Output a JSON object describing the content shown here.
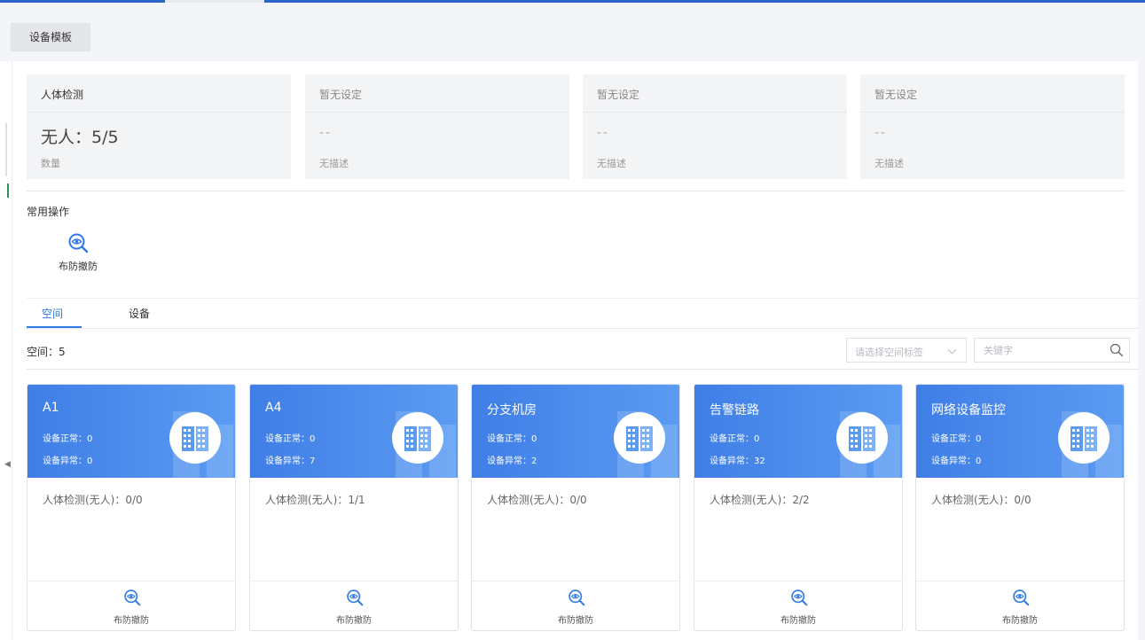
{
  "template_tab": "设备模板",
  "stats": [
    {
      "title": "人体检测",
      "value": "无人：5/5",
      "desc": "数量"
    },
    {
      "title": "暂无设定",
      "value": "--",
      "desc": "无描述"
    },
    {
      "title": "暂无设定",
      "value": "--",
      "desc": "无描述"
    },
    {
      "title": "暂无设定",
      "value": "--",
      "desc": "无描述"
    }
  ],
  "quick_ops": {
    "title": "常用操作",
    "items": [
      {
        "label": "布防撤防",
        "icon": "eye-search-icon"
      }
    ]
  },
  "tabs": [
    {
      "label": "空间",
      "active": true
    },
    {
      "label": "设备",
      "active": false
    }
  ],
  "space_count": "空间：5",
  "filter": {
    "tag_placeholder": "请选择空间标签",
    "keyword_placeholder": "关键字"
  },
  "spaces": [
    {
      "name": "A1",
      "normal": "设备正常：0",
      "abnormal": "设备异常：0",
      "detection": "人体检测(无人)：0/0",
      "action": "布防撤防"
    },
    {
      "name": "A4",
      "normal": "设备正常：0",
      "abnormal": "设备异常：7",
      "detection": "人体检测(无人)：1/1",
      "action": "布防撤防"
    },
    {
      "name": "分支机房",
      "normal": "设备正常：0",
      "abnormal": "设备异常：2",
      "detection": "人体检测(无人)：0/0",
      "action": "布防撤防"
    },
    {
      "name": "告警链路",
      "normal": "设备正常：0",
      "abnormal": "设备异常：32",
      "detection": "人体检测(无人)：2/2",
      "action": "布防撤防"
    },
    {
      "name": "网络设备监控",
      "normal": "设备正常：0",
      "abnormal": "设备异常：0",
      "detection": "人体检测(无人)：0/0",
      "action": "布防撤防"
    }
  ],
  "colors": {
    "accent": "#2f7ae5",
    "card_header_start": "#3f7ee6",
    "card_header_end": "#5b9bf2"
  }
}
